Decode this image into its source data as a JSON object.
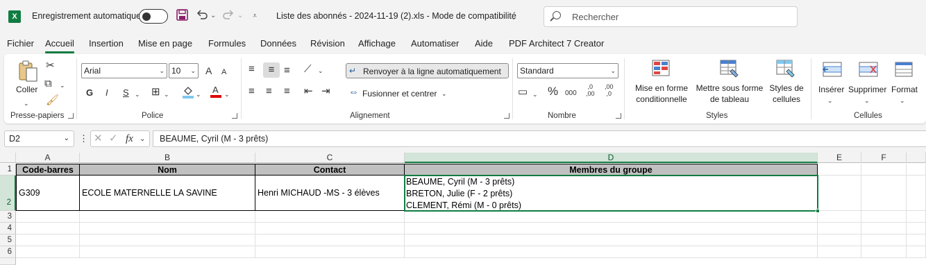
{
  "titlebar": {
    "app_icon": "X",
    "autosave_label": "Enregistrement automatique",
    "filename": "Liste des abonnés - 2024-11-19 (2).xls  -  Mode de compatibilité",
    "search_placeholder": "Rechercher"
  },
  "menu": {
    "tabs": [
      "Fichier",
      "Accueil",
      "Insertion",
      "Mise en page",
      "Formules",
      "Données",
      "Révision",
      "Affichage",
      "Automatiser",
      "Aide",
      "PDF Architect 7 Creator"
    ],
    "active_tab": "Accueil"
  },
  "ribbon": {
    "clipboard": {
      "label": "Presse-papiers",
      "paste": "Coller"
    },
    "font": {
      "label": "Police",
      "name": "Arial",
      "size": "10",
      "grow": "A",
      "shrink": "A",
      "bold": "G",
      "italic": "I",
      "underline": "S"
    },
    "alignment": {
      "label": "Alignement",
      "wrap": "Renvoyer à la ligne automatiquement",
      "merge": "Fusionner et centrer"
    },
    "number": {
      "label": "Nombre",
      "format": "Standard",
      "percent": "%",
      "thousands": "000",
      "inc_decimal": ",0\n,00",
      "dec_decimal": ",00\n,0"
    },
    "styles": {
      "label": "Styles",
      "conditional": "Mise en forme\nconditionnelle",
      "as_table": "Mettre sous forme\nde tableau",
      "cell_styles": "Styles de\ncellules"
    },
    "cells": {
      "label": "Cellules",
      "insert": "Insérer",
      "delete": "Supprimer",
      "format": "Format"
    }
  },
  "formula_bar": {
    "name_box": "D2",
    "fx": "fx",
    "content": "BEAUME, Cyril (M - 3 prêts)"
  },
  "sheet": {
    "columns": [
      "A",
      "B",
      "C",
      "D",
      "E",
      "F"
    ],
    "rows": [
      "1",
      "2",
      "3",
      "4",
      "5",
      "6"
    ],
    "headers": [
      "Code-barres",
      "Nom",
      "Contact",
      "Membres du groupe"
    ],
    "row2": {
      "code": "G309",
      "nom": "ECOLE MATERNELLE LA SAVINE",
      "contact": "Henri MICHAUD -MS - 3 élèves",
      "membres": [
        "BEAUME, Cyril (M - 3 prêts)",
        "BRETON, Julie (F - 2 prêts)",
        "CLEMENT, Rémi (M - 0 prêts)"
      ]
    },
    "selected_cell": "D2"
  }
}
